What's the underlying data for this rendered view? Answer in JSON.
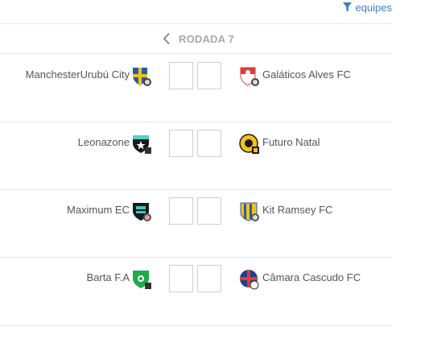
{
  "filter": {
    "label": "equipes",
    "icon": "filter-funnel-icon",
    "color": "#3a7fc1"
  },
  "round": {
    "label": "RODADA 7",
    "prev_icon": "chevron-left-icon"
  },
  "matches": [
    {
      "home": {
        "name": "ManchesterUrubú City",
        "crest": "shield-crest-icon",
        "colors": [
          "#2a5aa8",
          "#f0c419"
        ]
      },
      "away": {
        "name": "Galáticos Alves FC",
        "crest": "shield-crest-icon",
        "colors": [
          "#e23b3b",
          "#ffffff"
        ]
      },
      "home_score": "",
      "away_score": ""
    },
    {
      "home": {
        "name": "Leonazone",
        "crest": "shield-crest-icon",
        "colors": [
          "#1a1a1a",
          "#4fd1c5"
        ]
      },
      "away": {
        "name": "Futuro Natal",
        "crest": "shield-crest-icon",
        "colors": [
          "#f2c21b",
          "#1a1a1a"
        ]
      },
      "home_score": "",
      "away_score": ""
    },
    {
      "home": {
        "name": "Maximum EC",
        "crest": "shield-crest-icon",
        "colors": [
          "#1a1a1a",
          "#3fc6c0"
        ]
      },
      "away": {
        "name": "Kit Ramsey FC",
        "crest": "shield-crest-icon",
        "colors": [
          "#f2c21b",
          "#2a5aa8"
        ]
      },
      "home_score": "",
      "away_score": ""
    },
    {
      "home": {
        "name": "Barta F.A",
        "crest": "shield-crest-icon",
        "colors": [
          "#1faa4a",
          "#ffffff"
        ]
      },
      "away": {
        "name": "Câmara Cascudo FC",
        "crest": "shield-crest-icon",
        "colors": [
          "#1f3f8f",
          "#e23b3b"
        ]
      },
      "home_score": "",
      "away_score": ""
    }
  ]
}
